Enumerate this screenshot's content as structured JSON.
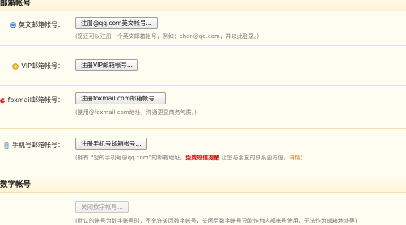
{
  "sections": {
    "email_accounts": "邮箱帐号",
    "digital_accounts": "数字帐号"
  },
  "rows": {
    "english": {
      "label": "英文邮箱帐号：",
      "button": "注册@qq.com英文帐号...",
      "hint": "(您还可以注册一个英文邮箱帐号，例如：chen@qq.com，并以此登录。)"
    },
    "vip": {
      "label": "VIP邮箱帐号：",
      "button": "注册VIP邮箱帐号..."
    },
    "foxmail": {
      "label": "foxmail邮箱帐号：",
      "button": "注册foxmail.com邮箱帐号...",
      "hint": "(使用@foxmail.com地址，沟通更显商务气质。)"
    },
    "mobile": {
      "label": "手机号邮箱帐号：",
      "button": "注册手机号邮箱帐号...",
      "hint_pre": "(拥有 “您的手机号@qq.com”的邮箱地址，",
      "hint_red": "免费短信提醒",
      "hint_mid": " 让您与朋友的联系更方便。",
      "hint_link": "详情",
      "hint_post": ")"
    },
    "digital": {
      "button": "关闭数字帐号...",
      "hint": "(默认的帐号为数字帐号时，不允许关闭数字帐号，关闭后数字帐号只能作为内部帐号使用，无法作为邮箱地址等)"
    }
  },
  "colors": {
    "background": "#fffcf2",
    "divider": "#f3e3b3",
    "highlight": "#d80000",
    "link": "#c87a00"
  }
}
